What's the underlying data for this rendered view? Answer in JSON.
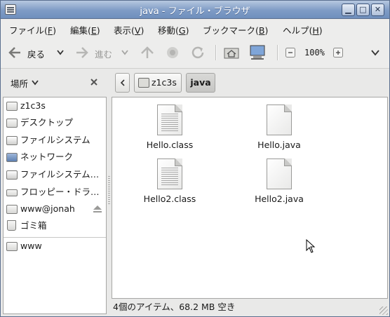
{
  "window": {
    "title": "java - ファイル・ブラウザ"
  },
  "menu": [
    {
      "label": "ファイル(",
      "key": "F",
      "end": ")"
    },
    {
      "label": "編集(",
      "key": "E",
      "end": ")"
    },
    {
      "label": "表示(",
      "key": "V",
      "end": ")"
    },
    {
      "label": "移動(",
      "key": "G",
      "end": ")"
    },
    {
      "label": "ブックマーク(",
      "key": "B",
      "end": ")"
    },
    {
      "label": "ヘルプ(",
      "key": "H",
      "end": ")"
    }
  ],
  "toolbar": {
    "back_label": "戻る",
    "forward_label": "進む",
    "zoom": "100%"
  },
  "sidebar": {
    "header": "場所",
    "items": [
      {
        "label": "z1c3s",
        "icon": "home-folder-icon"
      },
      {
        "label": "デスクトップ",
        "icon": "desktop-folder-icon"
      },
      {
        "label": "ファイルシステム",
        "icon": "drive-icon"
      },
      {
        "label": "ネットワーク",
        "icon": "network-icon"
      },
      {
        "label": "ファイルシステム…",
        "icon": "drive-icon"
      },
      {
        "label": "フロッピー・ドラ…",
        "icon": "floppy-icon"
      },
      {
        "label": "www@jonah",
        "icon": "network-folder-icon"
      },
      {
        "label": "ゴミ箱",
        "icon": "trash-icon"
      }
    ],
    "bookmarks": [
      {
        "label": "www",
        "icon": "folder-icon"
      }
    ]
  },
  "path": {
    "items": [
      "z1c3s",
      "java"
    ]
  },
  "files": [
    {
      "name": "Hello.class",
      "icon": "text-file-icon"
    },
    {
      "name": "Hello.java",
      "icon": "blank-file-icon"
    },
    {
      "name": "Hello2.class",
      "icon": "text-file-icon"
    },
    {
      "name": "Hello2.java",
      "icon": "blank-file-icon"
    }
  ],
  "status": {
    "text": "4個のアイテム、68.2 MB 空き"
  }
}
